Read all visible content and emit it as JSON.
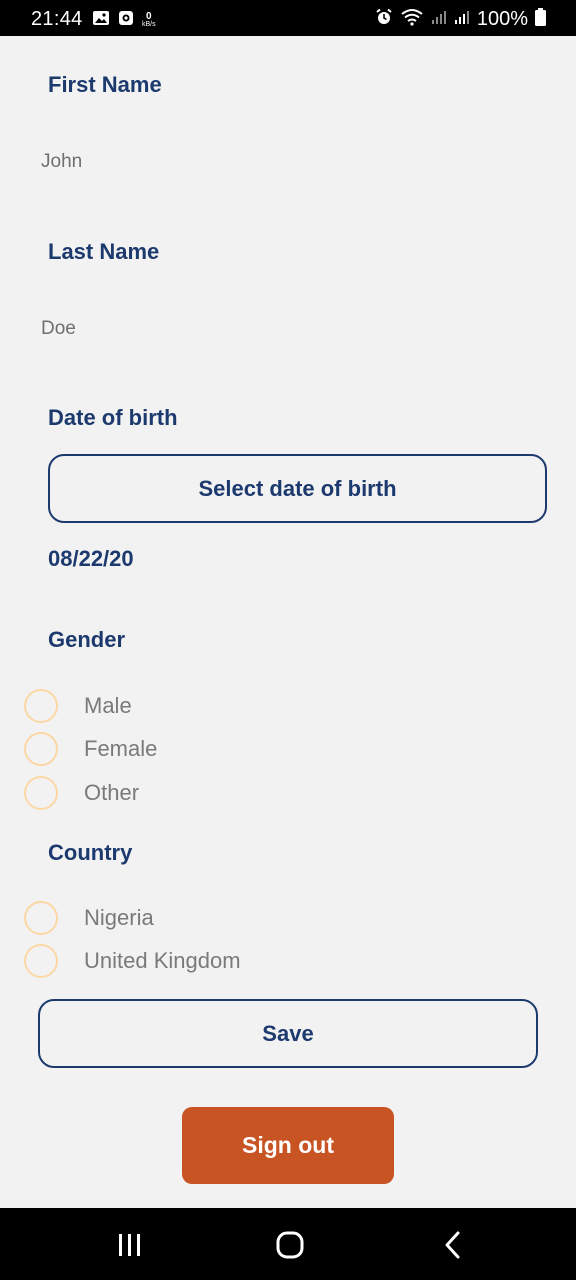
{
  "status_bar": {
    "time": "21:44",
    "data_speed_value": "0",
    "data_speed_unit": "kB/s",
    "battery_text": "100%",
    "icons": [
      "image-icon",
      "screen-record-icon",
      "alarm-icon",
      "wifi-icon",
      "signal-icon",
      "signal-icon",
      "battery-icon"
    ]
  },
  "form": {
    "first_name_label": "First Name",
    "first_name_value": "John",
    "last_name_label": "Last Name",
    "last_name_value": "Doe",
    "dob_label": "Date of birth",
    "dob_button": "Select date of birth",
    "dob_value": "08/22/20",
    "gender_label": "Gender",
    "gender_options": [
      "Male",
      "Female",
      "Other"
    ],
    "country_label": "Country",
    "country_options": [
      "Nigeria",
      "United Kingdom"
    ],
    "save_button": "Save",
    "signout_button": "Sign out"
  },
  "colors": {
    "label": "#1d3a6e",
    "radio_border": "#fcd7a5",
    "signout_bg": "#c95423",
    "background": "#f2f2f2"
  },
  "nav_bar": {
    "icons": [
      "recent-apps-icon",
      "home-icon",
      "back-icon"
    ]
  }
}
